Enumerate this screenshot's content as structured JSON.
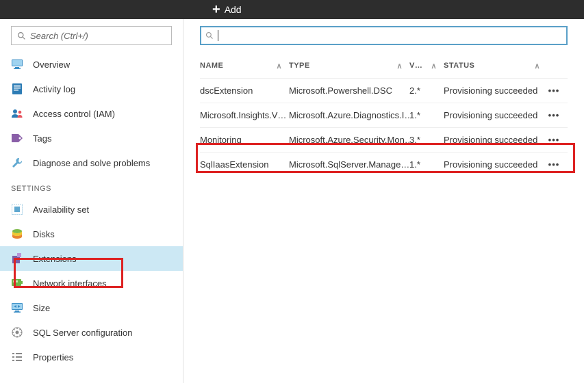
{
  "topbar": {
    "add_label": "Add"
  },
  "sidebar": {
    "search_placeholder": "Search (Ctrl+/)",
    "section1": [
      {
        "label": "Overview",
        "icon": "monitor"
      },
      {
        "label": "Activity log",
        "icon": "log"
      },
      {
        "label": "Access control (IAM)",
        "icon": "people"
      },
      {
        "label": "Tags",
        "icon": "tag"
      },
      {
        "label": "Diagnose and solve problems",
        "icon": "wrench"
      }
    ],
    "settings_header": "SETTINGS",
    "section2": [
      {
        "label": "Availability set",
        "icon": "availset"
      },
      {
        "label": "Disks",
        "icon": "disks"
      },
      {
        "label": "Extensions",
        "icon": "extension",
        "selected": true
      },
      {
        "label": "Network interfaces",
        "icon": "nic"
      },
      {
        "label": "Size",
        "icon": "size"
      },
      {
        "label": "SQL Server configuration",
        "icon": "sql"
      },
      {
        "label": "Properties",
        "icon": "properties"
      }
    ]
  },
  "table": {
    "headers": {
      "name": "NAME",
      "type": "TYPE",
      "version": "V…",
      "status": "STATUS"
    },
    "rows": [
      {
        "name": "dscExtension",
        "type": "Microsoft.Powershell.DSC",
        "version": "2.*",
        "status": "Provisioning succeeded"
      },
      {
        "name": "Microsoft.Insights.V…",
        "type": "Microsoft.Azure.Diagnostics.I…",
        "version": "1.*",
        "status": "Provisioning succeeded"
      },
      {
        "name": "Monitoring",
        "type": "Microsoft.Azure.Security.Mon…",
        "version": "3.*",
        "status": "Provisioning succeeded"
      },
      {
        "name": "SqlIaasExtension",
        "type": "Microsoft.SqlServer.Manage…",
        "version": "1.*",
        "status": "Provisioning succeeded"
      }
    ]
  }
}
